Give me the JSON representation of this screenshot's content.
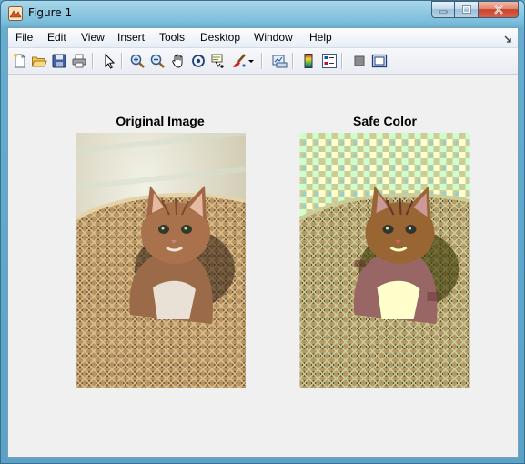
{
  "window": {
    "title": "Figure 1",
    "icon": "matlab-figure-icon",
    "buttons": [
      "minimize-icon",
      "maximize-icon",
      "close-icon"
    ]
  },
  "menu": {
    "items": [
      "File",
      "Edit",
      "View",
      "Insert",
      "Tools",
      "Desktop",
      "Window",
      "Help"
    ],
    "dock_icon": "dock-arrow-icon"
  },
  "toolbar": {
    "buttons": [
      "new-figure-icon",
      "open-file-icon",
      "save-icon",
      "print-icon",
      "edit-plot-icon",
      "zoom-in-icon",
      "zoom-out-icon",
      "pan-icon",
      "rotate-3d-icon",
      "data-cursor-icon",
      "brush-icon",
      "brush-dropdown-icon",
      "link-plot-icon",
      "colorbar-icon",
      "legend-icon",
      "hide-plot-tools-icon",
      "show-plot-tools-icon"
    ]
  },
  "axes": [
    {
      "title": "Original Image",
      "image": "kitten-in-straw-hat-photo"
    },
    {
      "title": "Safe Color",
      "image": "kitten-in-straw-hat-safe-color-dithered"
    }
  ],
  "colors": {
    "figure_bg": "#f0f0f0",
    "titlebar_top": "#a9d6ea",
    "close_button": "#c9442a"
  }
}
